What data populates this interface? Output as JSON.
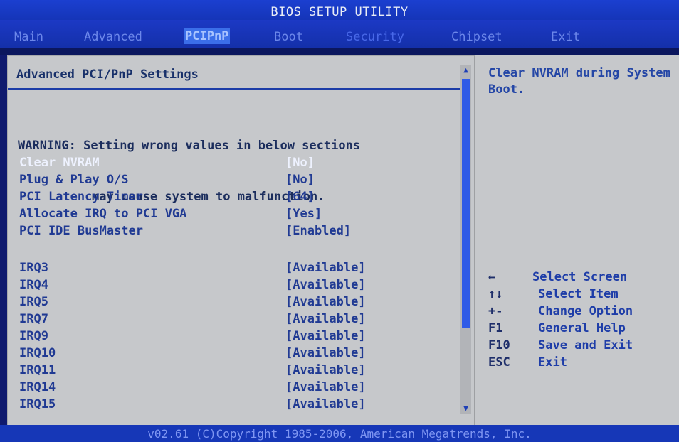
{
  "app_title": "BIOS SETUP UTILITY",
  "menu": {
    "items": [
      {
        "label": "Main"
      },
      {
        "label": "Advanced"
      },
      {
        "label": "PCIPnP"
      },
      {
        "label": "Boot"
      },
      {
        "label": "Security"
      },
      {
        "label": "Chipset"
      },
      {
        "label": "Exit"
      }
    ],
    "active_item": "PCIPnP"
  },
  "left_panel": {
    "heading": "Advanced PCI/PnP Settings",
    "warning_line1": "WARNING: Setting wrong values in below sections",
    "warning_line2": "may cause system to malfunction.",
    "settings": [
      {
        "label": "Clear NVRAM",
        "value": "[No]",
        "selected": true
      },
      {
        "label": "Plug & Play O/S",
        "value": "[No]"
      },
      {
        "label": "PCI Latency Timer",
        "value": "[64]"
      },
      {
        "label": "Allocate IRQ to PCI VGA",
        "value": "[Yes]"
      },
      {
        "label": "PCI IDE BusMaster",
        "value": "[Enabled]"
      },
      {
        "label": "IRQ3",
        "value": "[Available]"
      },
      {
        "label": "IRQ4",
        "value": "[Available]"
      },
      {
        "label": "IRQ5",
        "value": "[Available]"
      },
      {
        "label": "IRQ7",
        "value": "[Available]"
      },
      {
        "label": "IRQ9",
        "value": "[Available]"
      },
      {
        "label": "IRQ10",
        "value": "[Available]"
      },
      {
        "label": "IRQ11",
        "value": "[Available]"
      },
      {
        "label": "IRQ14",
        "value": "[Available]"
      },
      {
        "label": "IRQ15",
        "value": "[Available]"
      }
    ]
  },
  "scrollbar": {
    "up_icon": "▲",
    "down_icon": "▼"
  },
  "help": {
    "text": "Clear NVRAM during System Boot."
  },
  "key_legend": [
    {
      "key": "←",
      "action": "Select Screen"
    },
    {
      "key": "↑↓",
      "action": "Select Item"
    },
    {
      "key": "+-",
      "action": "Change Option"
    },
    {
      "key": "F1",
      "action": "General Help"
    },
    {
      "key": "F10",
      "action": "Save and Exit"
    },
    {
      "key": "ESC",
      "action": "Exit"
    }
  ],
  "footer": {
    "copyright": "v02.61 (C)Copyright 1985-2006, American Megatrends, Inc."
  },
  "colors": {
    "menu_bar": "#1a35bf",
    "panel_bg": "#c6c8cb",
    "selected_text": "#eef2ff",
    "setting_text": "#203a93"
  }
}
